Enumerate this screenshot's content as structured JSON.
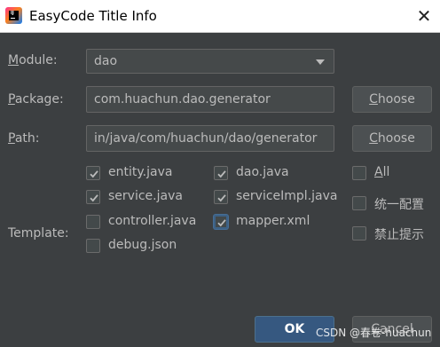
{
  "window": {
    "title": "EasyCode Title Info",
    "close_glyph": "✕"
  },
  "module": {
    "label_mnemonic": "M",
    "label_rest": "odule:",
    "value": "dao"
  },
  "package": {
    "label_mnemonic": "P",
    "label_rest": "ackage:",
    "value": "com.huachun.dao.generator",
    "choose_mnemonic": "C",
    "choose_rest": "hoose"
  },
  "path": {
    "label_mnemonic": "P",
    "label_rest": "ath:",
    "value": "in/java/com/huachun/dao/generator",
    "choose_mnemonic": "C",
    "choose_rest": "hoose"
  },
  "template": {
    "label": "Template:",
    "items": [
      {
        "label": "entity.java",
        "checked": true
      },
      {
        "label": "dao.java",
        "checked": true
      },
      {
        "label": "service.java",
        "checked": true
      },
      {
        "label": "serviceImpl.java",
        "checked": true
      },
      {
        "label": "controller.java",
        "checked": false
      },
      {
        "label": "mapper.xml",
        "checked": true
      },
      {
        "label": "debug.json",
        "checked": false
      }
    ]
  },
  "options": [
    {
      "label_mnemonic": "A",
      "label_rest": "ll",
      "checked": false
    },
    {
      "label": "统一配置",
      "checked": false
    },
    {
      "label": "禁止提示",
      "checked": false
    }
  ],
  "footer": {
    "ok_label": "OK",
    "cancel_label": "Cancel"
  },
  "watermark": "CSDN @春卷-huachun",
  "colors": {
    "background": "#3c3f41",
    "text": "#bbbbbb",
    "primary": "#365880",
    "field": "#45494a"
  }
}
